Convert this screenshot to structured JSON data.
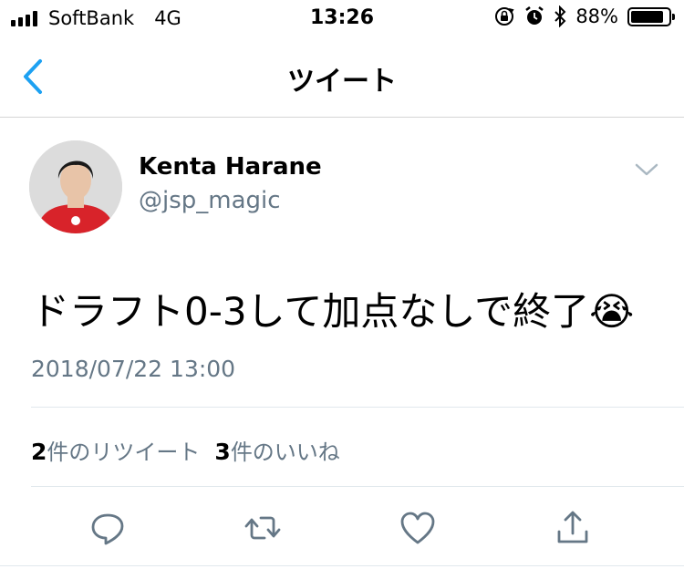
{
  "status_bar": {
    "carrier": "SoftBank",
    "network": "4G",
    "time": "13:26",
    "battery_percent": "88%",
    "battery_level": 0.88,
    "icons": [
      "signal-bars-icon",
      "rotation-lock-icon",
      "alarm-icon",
      "bluetooth-icon",
      "battery-icon"
    ]
  },
  "nav": {
    "title": "ツイート",
    "back_icon": "chevron-left-icon",
    "accent_color": "#1da1f2"
  },
  "tweet": {
    "display_name": "Kenta Harane",
    "handle": "@jsp_magic",
    "text": "ドラフト0-3して加点なしで終了",
    "emoji": "😭",
    "timestamp": "2018/07/22 13:00",
    "retweet_count": "2",
    "retweet_label": "件のリツイート",
    "like_count": "3",
    "like_label": "件のいいね"
  },
  "actions": [
    "reply-icon",
    "retweet-icon",
    "like-icon",
    "share-icon"
  ],
  "colors": {
    "secondary_text": "#657786",
    "icon_gray": "#657786",
    "divider": "#e1e8ed"
  }
}
